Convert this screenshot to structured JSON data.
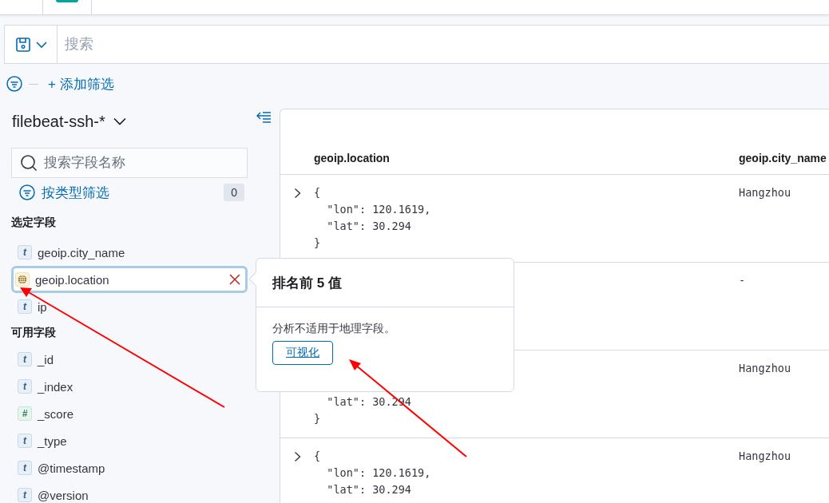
{
  "query_bar": {
    "placeholder": "搜索"
  },
  "filter_bar": {
    "add_filter": "+ 添加筛选"
  },
  "sidebar": {
    "index_pattern": "filebeat-ssh-*",
    "field_search": {
      "placeholder": "搜索字段名称"
    },
    "type_filter": {
      "label": "按类型筛选",
      "count": "0"
    },
    "sections": [
      {
        "title": "选定字段",
        "fields": [
          {
            "name": "geoip.city_name",
            "kind": "string",
            "glyph": "t",
            "selected": false
          },
          {
            "name": "geoip.location",
            "kind": "geo",
            "selected": true
          },
          {
            "name": "ip",
            "kind": "string",
            "glyph": "t",
            "selected": false
          }
        ]
      },
      {
        "title": "可用字段",
        "fields": [
          {
            "name": "_id",
            "kind": "string",
            "glyph": "t",
            "selected": false
          },
          {
            "name": "_index",
            "kind": "string",
            "glyph": "t",
            "selected": false
          },
          {
            "name": "_score",
            "kind": "number",
            "glyph": "#",
            "selected": false
          },
          {
            "name": "_type",
            "kind": "string",
            "glyph": "t",
            "selected": false
          },
          {
            "name": "@timestamp",
            "kind": "string",
            "glyph": "t",
            "selected": false
          },
          {
            "name": "@version",
            "kind": "string",
            "glyph": "t",
            "selected": false
          }
        ]
      }
    ]
  },
  "table": {
    "columns": [
      "geoip.location",
      "geoip.city_name"
    ],
    "rows": [
      {
        "expander": true,
        "location_lines": [
          "{",
          "  \"lon\": 120.1619,",
          "  \"lat\": 30.294",
          "}"
        ],
        "city": "Hangzhou"
      },
      {
        "location_lines": [],
        "city": "-"
      },
      {
        "covered_top": true,
        "location_lines": [
          "  \"lat\": 30.294",
          "}"
        ],
        "city": "Hangzhou"
      },
      {
        "expander": true,
        "covered_top": false,
        "location_lines": [
          "{",
          "  \"lon\": 120.1619,",
          "  \"lat\": 30.294"
        ],
        "city": "Hangzhou"
      }
    ]
  },
  "popover": {
    "title": "排名前 5 值",
    "message": "分析不适用于地理字段。",
    "button": "可视化"
  }
}
